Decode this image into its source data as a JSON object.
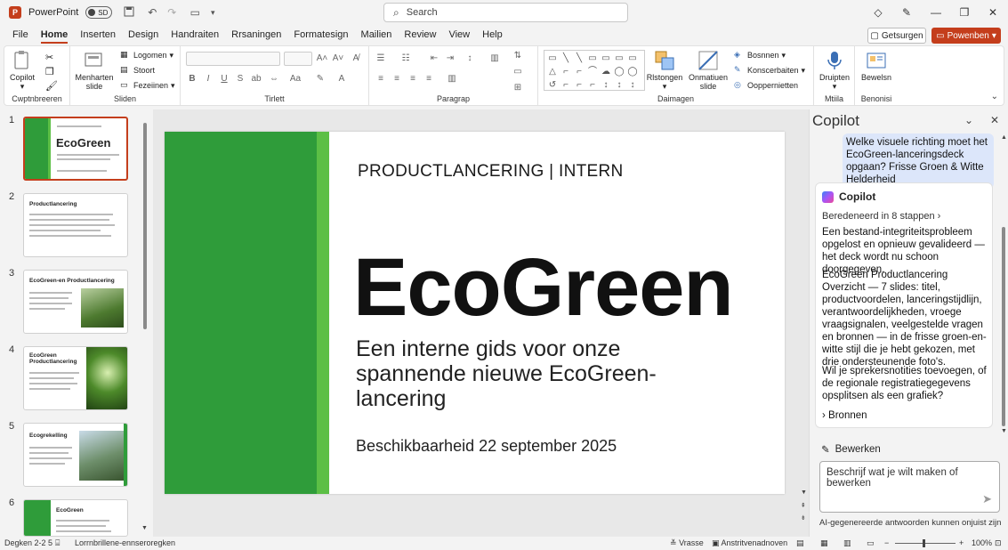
{
  "titlebar": {
    "app_name": "PowerPoint",
    "autosave_label": "SD",
    "search_placeholder": "Search"
  },
  "menu": {
    "tabs": [
      "File",
      "Home",
      "Inserten",
      "Design",
      "Handraiten",
      "Rrsaningen",
      "Formatesign",
      "Mailien",
      "Review",
      "View",
      "Help"
    ],
    "active": "Home",
    "getsurgen_label": "Getsurgen",
    "present_label": "Powenben"
  },
  "ribbon": {
    "copilot_label": "Copilot",
    "clipboard_group": "Cwptnbreeren",
    "new_slide_label": "Menharten slide",
    "layout_label": "Logomen",
    "reset_label": "Stoort",
    "section_label": "Fezeiinen",
    "slides_group": "Sliden",
    "font_group": "Tirlett",
    "paragraph_group": "Paragrap",
    "drawing_group": "Daimagen",
    "shapes_label": "Rlstongen",
    "arrange_label": "Onmatiuen slide",
    "fill_label": "Bosnnen",
    "outline_label": "Konscerbaiten",
    "effects_label": "Ooppernietten",
    "dictate_label": "Druipten",
    "media_group": "Mtiila",
    "designer_label": "Bewelsn",
    "designer_group": "Benonisi"
  },
  "thumbnails": [
    {
      "num": "1",
      "title": "EcoGreen",
      "selected": true
    },
    {
      "num": "2",
      "title": "Productlancering"
    },
    {
      "num": "3",
      "title": "EcoGreen-en Productlancering"
    },
    {
      "num": "4",
      "title": "EcoGreen Productlancering"
    },
    {
      "num": "5",
      "title": "Ecogrekelling"
    },
    {
      "num": "6",
      "title": "EcoGreen"
    }
  ],
  "slide": {
    "kicker": "PRODUCTLANCERING | INTERN",
    "title": "EcoGreen",
    "subtitle": "Een interne gids voor onze spannende nieuwe EcoGreen-lancering",
    "date": "Beschikbaarheid 22 september 2025"
  },
  "copilot": {
    "title": "Copilot",
    "user_message": "Welke visuele richting moet het EcoGreen-lanceringsdeck opgaan? Frisse Groen & Witte Helderheid",
    "response_header": "Copilot",
    "reasoning": "Beredeneerd in 8 stappen",
    "para1": "Een bestand-integriteitsprobleem opgelost en opnieuw gevalideerd — het deck wordt nu schoon doorgegeven.",
    "para2": "EcoGreen Productlancering Overzicht — 7 slides: titel, productvoordelen, lanceringstijdlijn, verantwoordelijkheden, vroege vraagsignalen, veelgestelde vragen en bronnen — in de frisse groen-en-witte stijl die je hebt gekozen, met drie ondersteunende foto's.",
    "para3": "Wil je sprekersnotities toevoegen, of de regionale registratiegegevens opsplitsen als een grafiek?",
    "sources": "Bronnen",
    "edit_label": "Bewerken",
    "input_placeholder": "Beschrijf wat je wilt maken of bewerken",
    "disclaimer": "AI-gegenereerde antwoorden kunnen onjuist zijn"
  },
  "status": {
    "slide_info": "Degken 2-2 5",
    "accessibility": "Lorrnbrillene-ennseroregken",
    "notes": "Vrasse",
    "display": "Anstritvenadnoven",
    "zoom": "100%"
  },
  "colors": {
    "accent": "#c43e1c",
    "slide_green_dark": "#2f9c3a",
    "slide_green_light": "#5cbf45",
    "user_bubble": "#dce6fa"
  }
}
